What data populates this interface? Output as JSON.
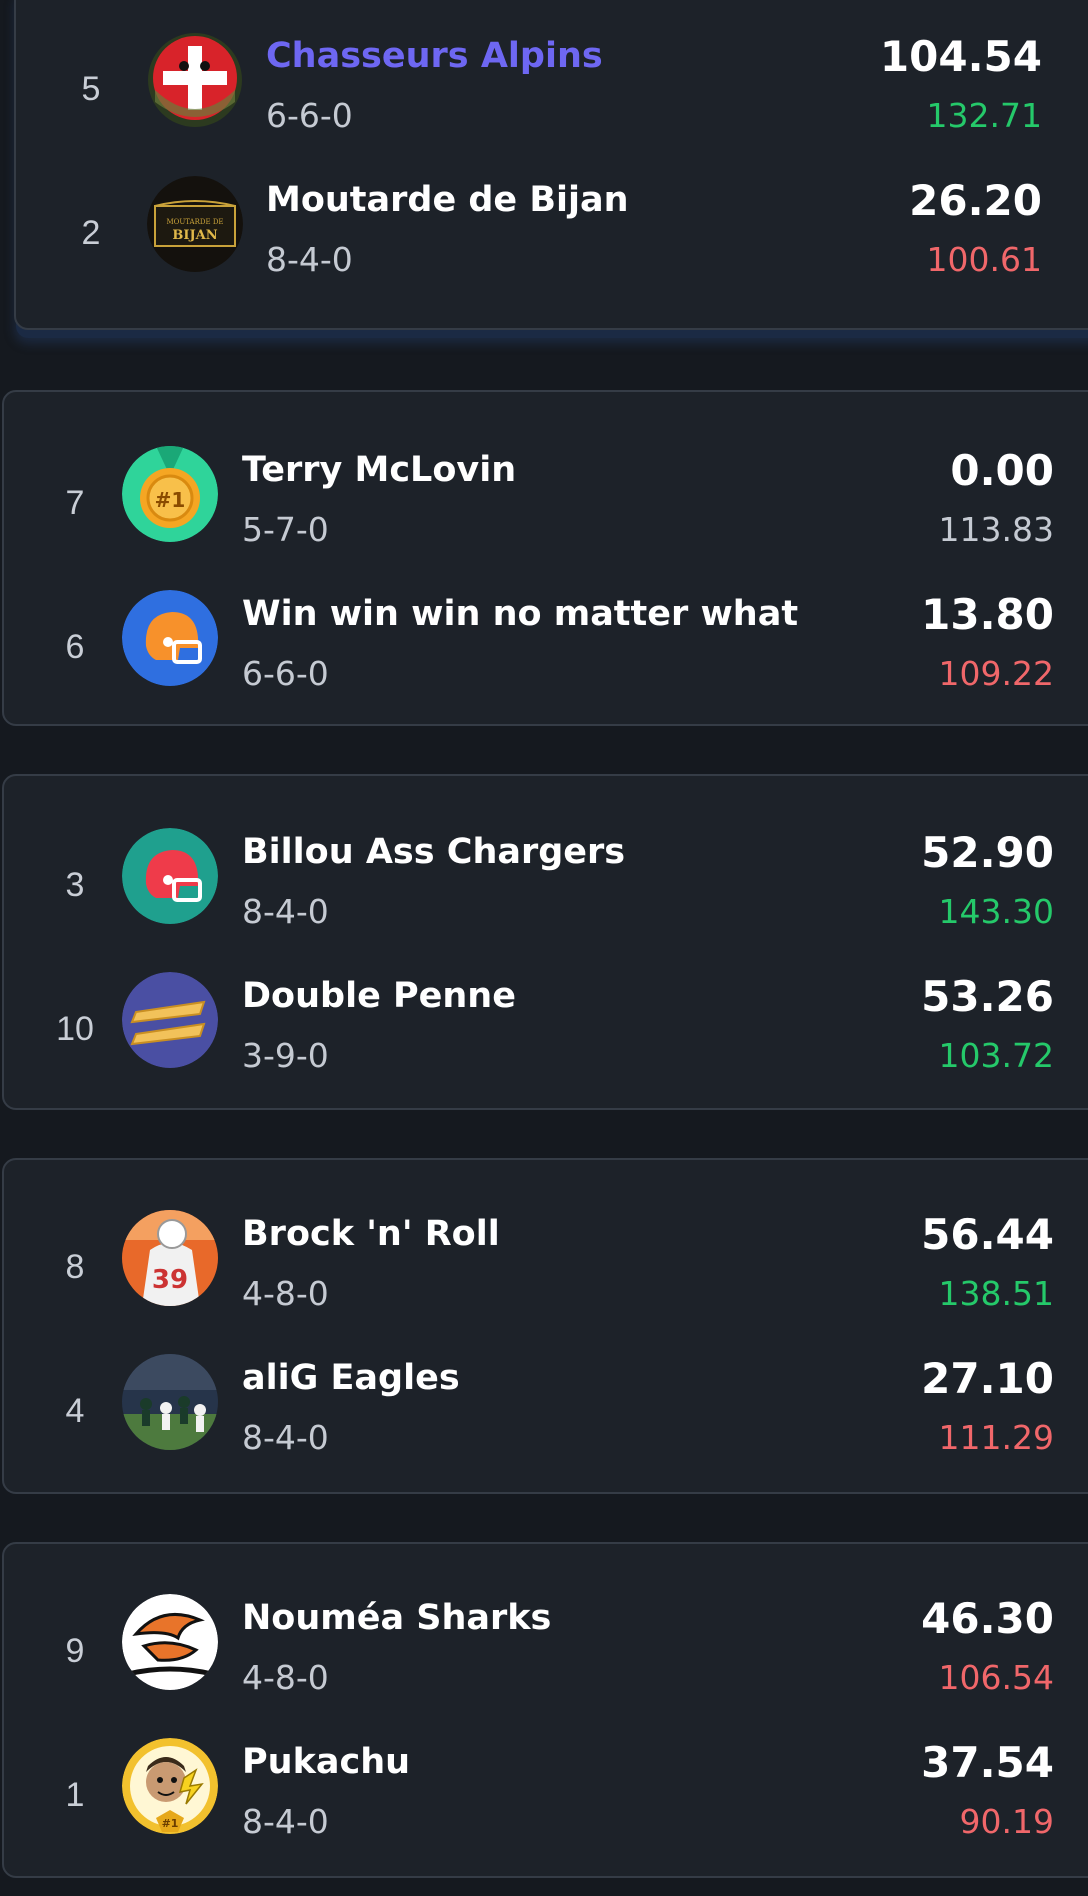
{
  "colors": {
    "background": "#15191f",
    "card": "#1d2229",
    "highlight_name": "#6e67f2",
    "win_green": "#25c96a",
    "loss_red": "#f0676a",
    "neutral": "#c5cad2"
  },
  "matchups": [
    {
      "teams": [
        {
          "rank": "5",
          "name": "Chasseurs Alpins",
          "record": "6-6-0",
          "score": "104.54",
          "projection": "132.71",
          "projection_status": "green",
          "avatar_icon": "swiss-cross-ball-icon",
          "highlighted": true
        },
        {
          "rank": "2",
          "name": "Moutarde de Bijan",
          "record": "8-4-0",
          "score": "26.20",
          "projection": "100.61",
          "projection_status": "red",
          "avatar_icon": "moutarde-label-icon",
          "avatar_text": "BIJAN"
        }
      ]
    },
    {
      "teams": [
        {
          "rank": "7",
          "name": "Terry McLovin",
          "record": "5-7-0",
          "score": "0.00",
          "projection": "113.83",
          "projection_status": "neutral",
          "avatar_icon": "gold-medal-icon",
          "avatar_text": "#1"
        },
        {
          "rank": "6",
          "name": "Win win win no matter what",
          "record": "6-6-0",
          "score": "13.80",
          "projection": "109.22",
          "projection_status": "red",
          "avatar_icon": "orange-helmet-icon"
        }
      ]
    },
    {
      "teams": [
        {
          "rank": "3",
          "name": "Billou Ass Chargers",
          "record": "8-4-0",
          "score": "52.90",
          "projection": "143.30",
          "projection_status": "green",
          "avatar_icon": "red-helmet-icon"
        },
        {
          "rank": "10",
          "name": "Double Penne",
          "record": "3-9-0",
          "score": "53.26",
          "projection": "103.72",
          "projection_status": "green",
          "avatar_icon": "penne-pasta-icon"
        }
      ]
    },
    {
      "teams": [
        {
          "rank": "8",
          "name": "Brock 'n' Roll",
          "record": "4-8-0",
          "score": "56.44",
          "projection": "138.51",
          "projection_status": "green",
          "avatar_icon": "football-player-photo-icon"
        },
        {
          "rank": "4",
          "name": "aliG Eagles",
          "record": "8-4-0",
          "score": "27.10",
          "projection": "111.29",
          "projection_status": "red",
          "avatar_icon": "stadium-photo-icon"
        }
      ]
    },
    {
      "teams": [
        {
          "rank": "9",
          "name": "Nouméa Sharks",
          "record": "4-8-0",
          "score": "46.30",
          "projection": "106.54",
          "projection_status": "red",
          "avatar_icon": "sharks-logo-icon"
        },
        {
          "rank": "1",
          "name": "Pukachu",
          "record": "8-4-0",
          "score": "37.54",
          "projection": "90.19",
          "projection_status": "red",
          "avatar_icon": "pikachu-champion-icon",
          "avatar_text": "#1"
        }
      ]
    }
  ]
}
